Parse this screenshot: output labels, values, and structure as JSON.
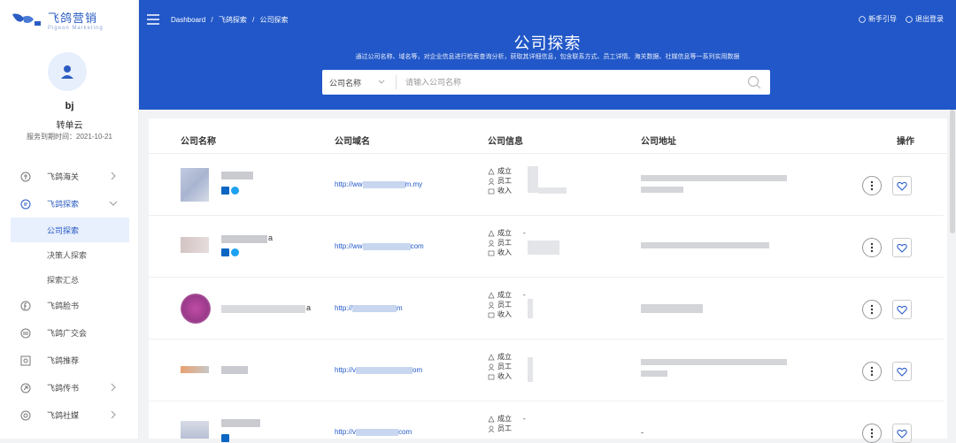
{
  "brand": {
    "name_cn": "飞鸽营销",
    "name_en": "Pigeon Marketing"
  },
  "user": {
    "name": "bj",
    "plan": "转单云",
    "expiry": "服务到期时间：2021-10-21"
  },
  "sidebar": {
    "items": [
      {
        "label": "飞鸽海关",
        "icon": "customs-icon",
        "expandable": true
      },
      {
        "label": "飞鸽探索",
        "icon": "explore-icon",
        "expandable": true,
        "expanded": true
      },
      {
        "label": "公司探索",
        "sub": true,
        "selected": true
      },
      {
        "label": "决策人探索",
        "sub": true
      },
      {
        "label": "探索汇总",
        "sub": true
      },
      {
        "label": "飞鸽脸书",
        "icon": "facebook-icon"
      },
      {
        "label": "飞鸽广交会",
        "icon": "fair-icon"
      },
      {
        "label": "飞鸽推荐",
        "icon": "recommend-icon"
      },
      {
        "label": "飞鸽传书",
        "icon": "send-icon",
        "expandable": true
      },
      {
        "label": "飞鸽社媒",
        "icon": "social-icon",
        "expandable": true
      }
    ]
  },
  "header": {
    "breadcrumb": [
      "Dashboard",
      "/",
      "飞鸽探索",
      "/",
      "公司探索"
    ],
    "guide": "新手引导",
    "logout": "退出登录",
    "title": "公司探索",
    "subtitle": "通过公司名称、域名等，对企业信息进行检索查询分析，获取其详细信息，包含联系方式、员工详情、海关数据、社媒信息等一系列实用数据",
    "search_type": "公司名称",
    "search_placeholder": "请输入公司名称"
  },
  "table": {
    "columns": [
      "公司名称",
      "公司域名",
      "公司信息",
      "公司地址",
      "操作"
    ],
    "info_labels": [
      "成立",
      "员工",
      "收入"
    ],
    "rows": [
      {
        "domain_prefix": "http://ww",
        "domain_suffix": "m.my",
        "has_li": true,
        "has_tw": true
      },
      {
        "domain_prefix": "http://ww",
        "domain_suffix": "com",
        "has_li": true,
        "has_tw": true,
        "name_tail": "a",
        "founded": "-"
      },
      {
        "domain_prefix": "http://",
        "domain_suffix": "m",
        "name_tail": "a",
        "founded": "-"
      },
      {
        "domain_prefix": "http://v",
        "domain_suffix": "om"
      },
      {
        "domain_prefix": "http://v",
        "domain_suffix": "com",
        "has_li": true,
        "founded": "-",
        "address": "-"
      }
    ]
  },
  "colors": {
    "primary": "#2157c8",
    "sidebar_selected_bg": "#e8effd"
  }
}
